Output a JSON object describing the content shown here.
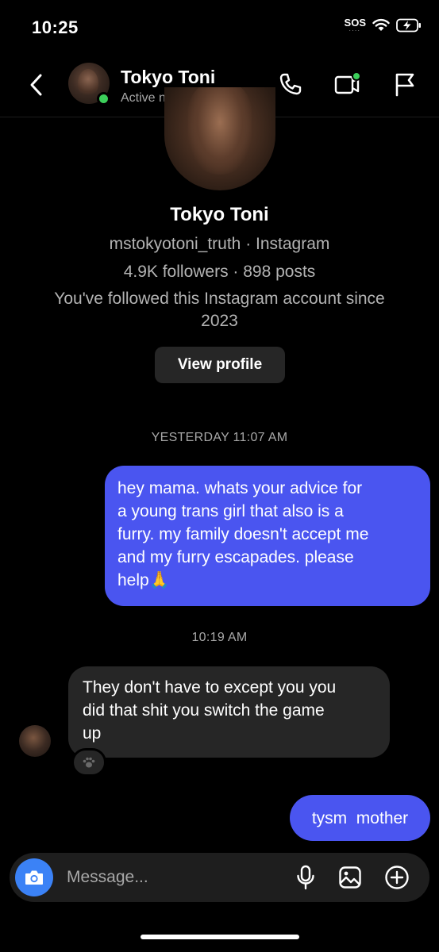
{
  "status_bar": {
    "time": "10:25",
    "sos": "SOS"
  },
  "header": {
    "name": "Tokyo Toni",
    "status": "Active now",
    "icons": [
      "back-icon",
      "phone-icon",
      "video-call-icon",
      "flag-icon"
    ]
  },
  "profile": {
    "name": "Tokyo Toni",
    "handle_line": "mstokyotoni_truth · Instagram",
    "stats_line": "4.9K followers · 898 posts",
    "follow_line_1": "You've followed this Instagram account since",
    "follow_line_2": "2023",
    "view_profile_label": "View profile"
  },
  "messages": {
    "timestamp_1": "YESTERDAY 11:07 AM",
    "sent_1": [
      "hey mama. whats your advice for",
      "a young trans girl that also is a",
      "furry. my family doesn't accept me",
      "and my furry escapades. please",
      "help"
    ],
    "sent_1_emoji": "🙏",
    "timestamp_2": "10:19 AM",
    "received_1": [
      "They don't have to except you you",
      "did that shit you switch the game",
      "up"
    ],
    "reaction_icon": "paw-icon",
    "sent_2": "tysm  mother"
  },
  "composer": {
    "placeholder": "Message...",
    "icons": [
      "camera-icon",
      "microphone-icon",
      "gallery-icon",
      "plus-circle-icon"
    ]
  },
  "colors": {
    "background": "#000000",
    "sent_bubble": "#4a55f0",
    "received_bubble": "#262626",
    "online": "#3ccf5a",
    "camera": "#3b82f6"
  }
}
